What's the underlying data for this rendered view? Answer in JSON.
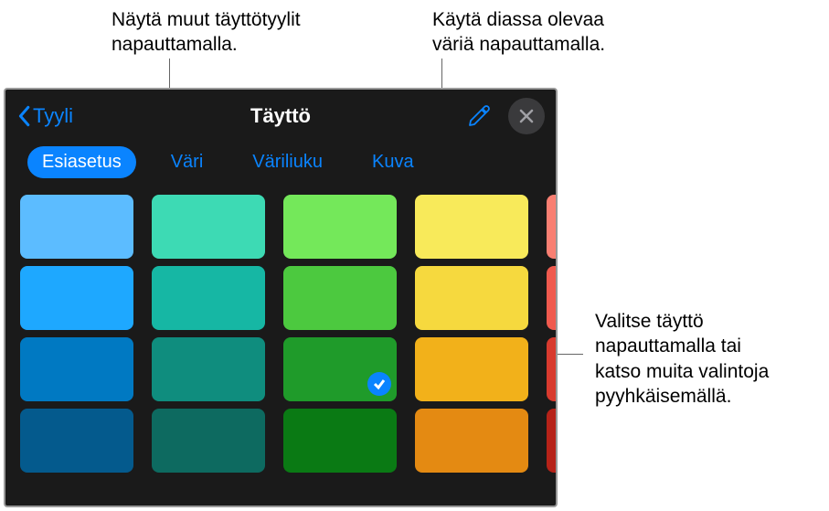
{
  "callouts": {
    "topLeft": "Näytä muut täyttötyylit\nnapauttamalla.",
    "topRight": "Käytä diassa olevaa\nväriä napauttamalla.",
    "right": "Valitse täyttö\nnapauttamalla tai\nkatso muita valintoja\npyyhkäisemällä."
  },
  "header": {
    "back": "Tyyli",
    "title": "Täyttö"
  },
  "tabs": [
    "Esiasetus",
    "Väri",
    "Väriliuku",
    "Kuva"
  ],
  "activeTab": 0,
  "swatchColumns": [
    {
      "colors": [
        "#5cbcff",
        "#1ea8ff",
        "#0079c2",
        "#045a8d"
      ]
    },
    {
      "colors": [
        "#3ddab4",
        "#16b7a4",
        "#0f8d7e",
        "#0d6a60"
      ]
    },
    {
      "colors": [
        "#74e85a",
        "#4cc93f",
        "#1f9b2a",
        "#0a7a14"
      ],
      "selected": 2
    },
    {
      "colors": [
        "#f8ea5a",
        "#f6d93e",
        "#f2b11a",
        "#e48a12"
      ]
    },
    {
      "colors": [
        "#f97f72",
        "#f05a4e",
        "#d83a2e",
        "#b62218"
      ],
      "edge": true
    }
  ]
}
